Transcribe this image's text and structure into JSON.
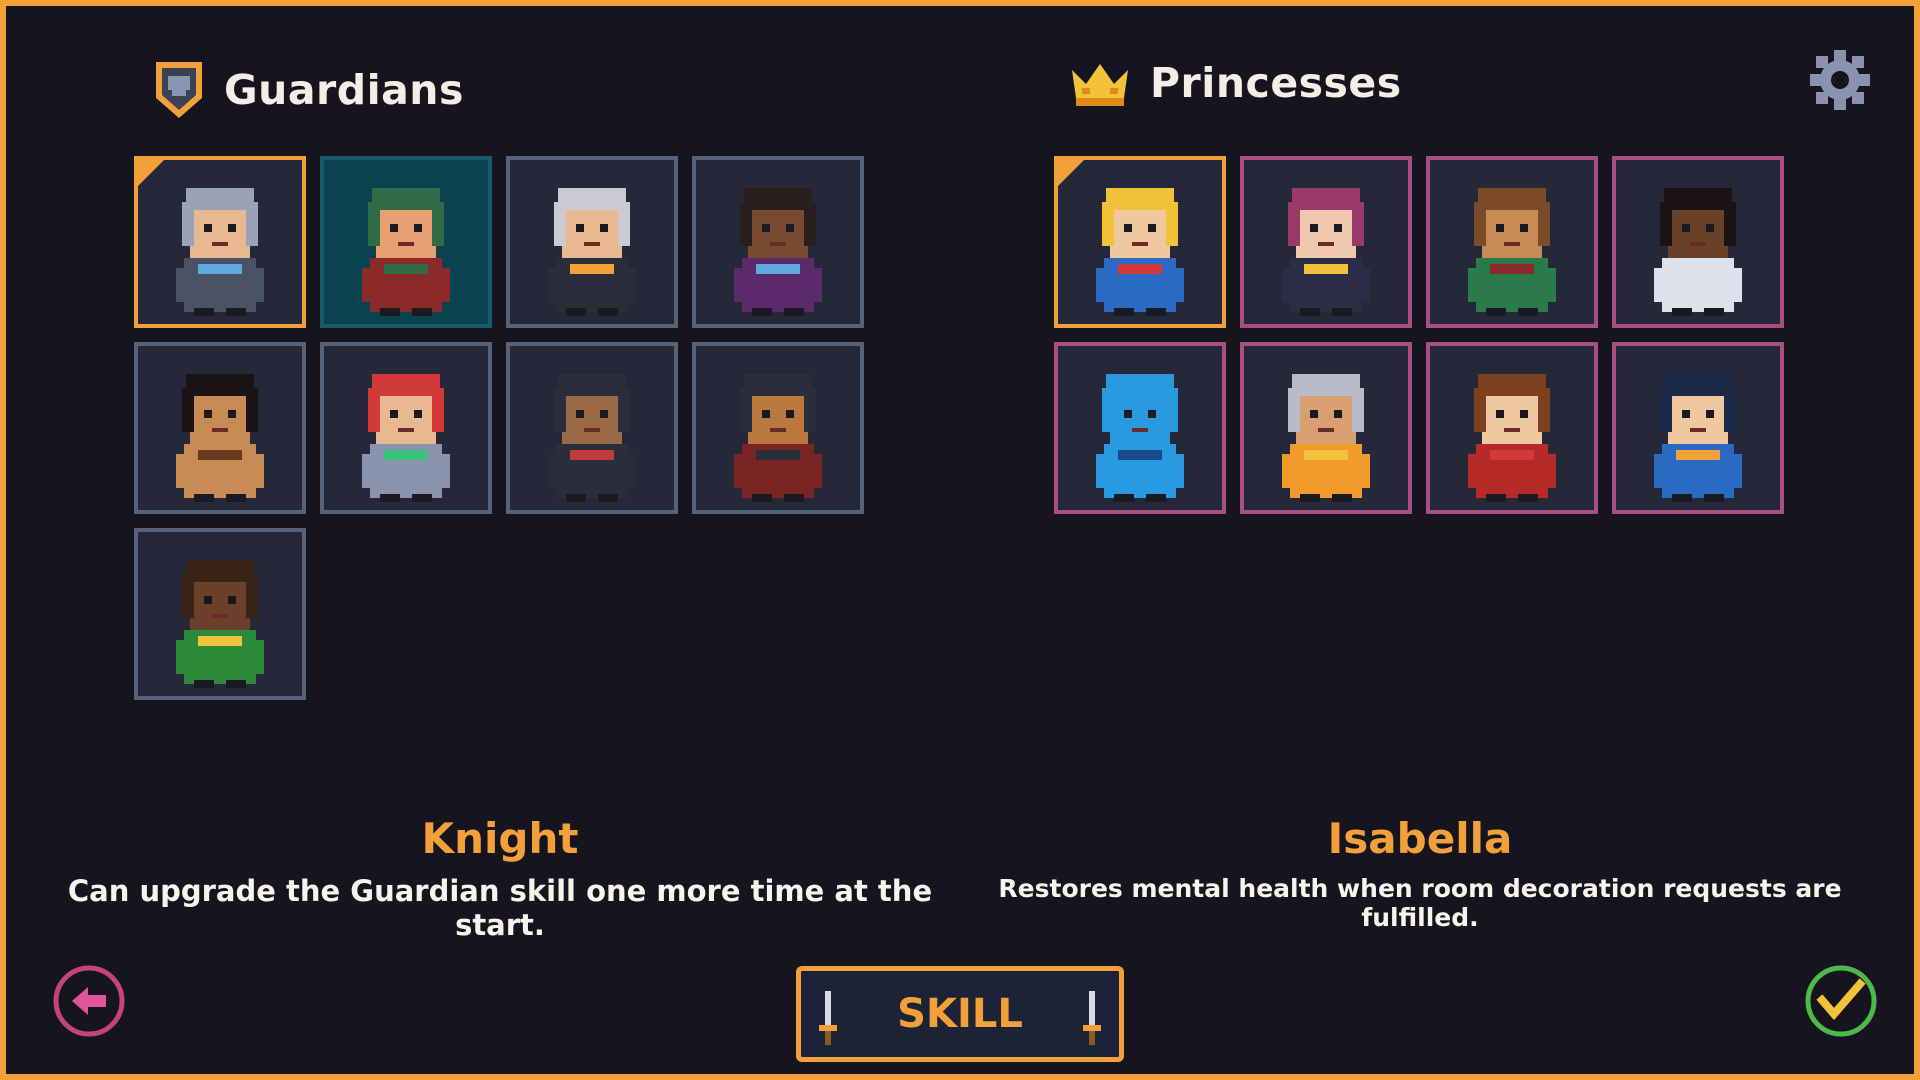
{
  "guardians": {
    "heading": "Guardians",
    "icon": "shield-icon",
    "selected": {
      "name": "Knight",
      "description": "Can upgrade the Guardian skill one more time at the start."
    },
    "characters": [
      {
        "id": "knight",
        "icon": "knight-portrait-icon",
        "hair": "#9aa3b5",
        "skin": "#e8b890",
        "outfit": "#4a5266",
        "accent": "#5fa9e0",
        "state": "selected"
      },
      {
        "id": "ranger",
        "icon": "ranger-portrait-icon",
        "hair": "#2e6b46",
        "skin": "#e8a070",
        "outfit": "#8c2a2a",
        "accent": "#2e6b46",
        "state": "hover"
      },
      {
        "id": "priestess",
        "icon": "priestess-portrait-icon",
        "hair": "#c9cad4",
        "skin": "#e8b890",
        "outfit": "#2a2d3a",
        "accent": "#f2a13a",
        "state": ""
      },
      {
        "id": "dancer",
        "icon": "dancer-portrait-icon",
        "hair": "#2a1f1f",
        "skin": "#7a4a30",
        "outfit": "#5a2a6a",
        "accent": "#5fa9e0",
        "state": ""
      },
      {
        "id": "barbarian",
        "icon": "barbarian-portrait-icon",
        "hair": "#1c1414",
        "skin": "#c98b55",
        "outfit": "#c98b55",
        "accent": "#6b3a1e",
        "state": ""
      },
      {
        "id": "engineer",
        "icon": "engineer-portrait-icon",
        "hair": "#d23a3a",
        "skin": "#e8b890",
        "outfit": "#8a93ad",
        "accent": "#3ac27a",
        "state": ""
      },
      {
        "id": "ninja",
        "icon": "ninja-portrait-icon",
        "hair": "#2a2d3a",
        "skin": "#9a6a48",
        "outfit": "#2a2d3a",
        "accent": "#c23a3a",
        "state": ""
      },
      {
        "id": "pirate",
        "icon": "pirate-portrait-icon",
        "hair": "#2a2d3a",
        "skin": "#b8783e",
        "outfit": "#7a2424",
        "accent": "#2a2d3a",
        "state": ""
      },
      {
        "id": "wrestler",
        "icon": "wrestler-portrait-icon",
        "hair": "#3a2418",
        "skin": "#6a4028",
        "outfit": "#2a8a3a",
        "accent": "#f2c23a",
        "state": ""
      }
    ]
  },
  "princesses": {
    "heading": "Princesses",
    "icon": "crown-icon",
    "selected": {
      "name": "Isabella",
      "description": "Restores mental health when room decoration requests are fulfilled."
    },
    "characters": [
      {
        "id": "isabella",
        "icon": "isabella-portrait-icon",
        "hair": "#f2c23a",
        "skin": "#f0c8a0",
        "outfit": "#2a6ac2",
        "accent": "#d23a3a",
        "state": "selected"
      },
      {
        "id": "noble-lady",
        "icon": "noble-lady-portrait-icon",
        "hair": "#9a3a6a",
        "skin": "#f0c8b0",
        "outfit": "#2a2d45",
        "accent": "#f2c23a",
        "state": ""
      },
      {
        "id": "cowgirl",
        "icon": "cowgirl-portrait-icon",
        "hair": "#7a4a2a",
        "skin": "#c98b55",
        "outfit": "#2a7a4a",
        "accent": "#8a2a2a",
        "state": ""
      },
      {
        "id": "bride",
        "icon": "bride-portrait-icon",
        "hair": "#1c1414",
        "skin": "#6a4028",
        "outfit": "#dde2ec",
        "accent": "#dde2ec",
        "state": ""
      },
      {
        "id": "veiled-lady",
        "icon": "veiled-lady-portrait-icon",
        "hair": "#2a9ae0",
        "skin": "#2a9ae0",
        "outfit": "#2a9ae0",
        "accent": "#1c4a8a",
        "state": ""
      },
      {
        "id": "old-queen",
        "icon": "old-queen-portrait-icon",
        "hair": "#b8bcc8",
        "skin": "#d8a070",
        "outfit": "#f29a2a",
        "accent": "#f2c23a",
        "state": ""
      },
      {
        "id": "young-girl",
        "icon": "young-girl-portrait-icon",
        "hair": "#7a4020",
        "skin": "#f0c8a0",
        "outfit": "#b82a2a",
        "accent": "#d23a3a",
        "state": ""
      },
      {
        "id": "blue-queen",
        "icon": "blue-queen-portrait-icon",
        "hair": "#1c2a4a",
        "skin": "#f0c8a0",
        "outfit": "#2a6ac2",
        "accent": "#f2a13a",
        "state": ""
      }
    ]
  },
  "skill_button": {
    "label": "SKILL"
  },
  "controls": {
    "back": "back-arrow-icon",
    "confirm": "checkmark-icon",
    "settings": "gear-icon"
  },
  "colors": {
    "accent": "#f2a13a",
    "background": "#16151f",
    "guardian_border": "#56627a",
    "princess_border": "#a94d84",
    "back_button": "#c2447a",
    "confirm_button": "#4fb84a"
  }
}
